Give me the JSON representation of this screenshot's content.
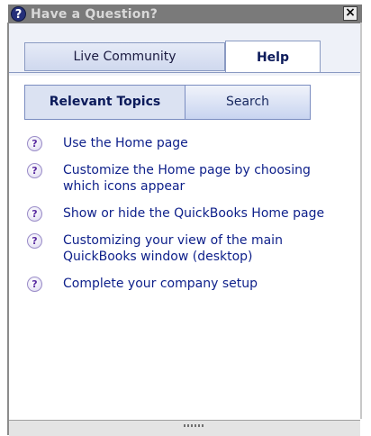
{
  "window": {
    "title": "Have a Question?",
    "title_icon": "question-icon",
    "close_label": "×",
    "close_icon": "close-icon"
  },
  "tabs": [
    {
      "label": "Live Community",
      "selected": false
    },
    {
      "label": "Help",
      "selected": true
    }
  ],
  "subtabs": [
    {
      "label": "Relevant Topics",
      "selected": true
    },
    {
      "label": "Search",
      "selected": false
    }
  ],
  "topic_icon": "question-circle-icon",
  "topics": [
    {
      "label": "Use the Home page"
    },
    {
      "label": "Customize the Home page by choosing which icons appear"
    },
    {
      "label": "Show or hide the QuickBooks Home page"
    },
    {
      "label": "Customizing your view of the main QuickBooks window (desktop)"
    },
    {
      "label": "Complete your company setup"
    }
  ],
  "colors": {
    "titlebar": "#7a7a7a",
    "link": "#0d1f8a",
    "tab_border": "#8a9ac2"
  }
}
